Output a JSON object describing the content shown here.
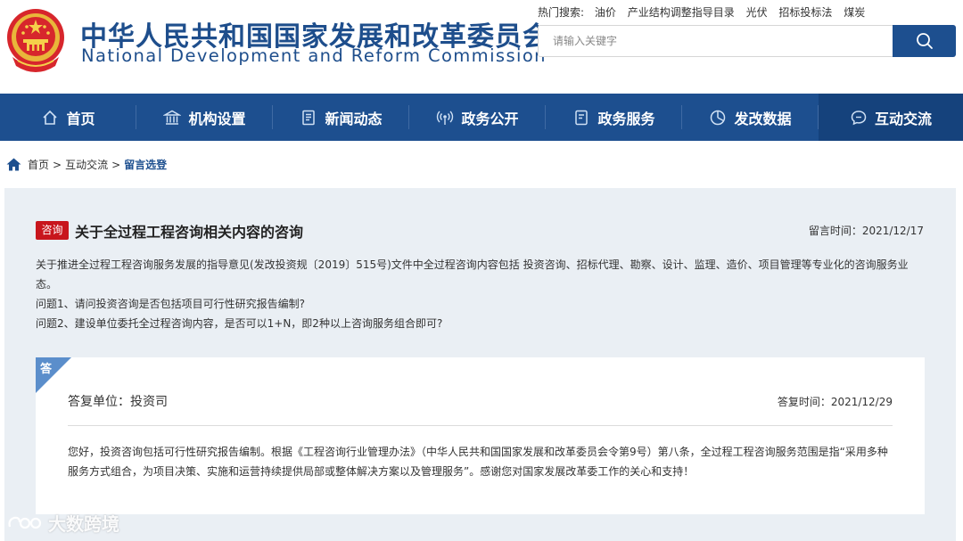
{
  "header": {
    "title_cn": "中华人民共和国国家发展和改革委员会",
    "title_en": "National Development and Reform Commission",
    "hot_label": "热门搜索:",
    "hot_items": [
      "油价",
      "产业结构调整指导目录",
      "光伏",
      "招标投标法",
      "煤炭"
    ],
    "search_placeholder": "请输入关键字"
  },
  "nav": {
    "items": [
      {
        "label": "首页",
        "icon": "home-icon"
      },
      {
        "label": "机构设置",
        "icon": "institution-icon"
      },
      {
        "label": "新闻动态",
        "icon": "news-icon"
      },
      {
        "label": "政务公开",
        "icon": "broadcast-icon"
      },
      {
        "label": "政务服务",
        "icon": "service-icon"
      },
      {
        "label": "发改数据",
        "icon": "pie-chart-icon"
      },
      {
        "label": "互动交流",
        "icon": "chat-icon"
      }
    ],
    "active_index": 6
  },
  "breadcrumb": {
    "items": [
      "首页",
      "互动交流"
    ],
    "current": "留言选登",
    "separator": ">"
  },
  "question": {
    "tag": "咨询",
    "title": "关于全过程工程咨询相关内容的咨询",
    "time": "留言时间：2021/12/17",
    "paragraphs": [
      "关于推进全过程工程咨询服务发展的指导意见(发改投资规〔2019〕515号)文件中全过程咨询内容包括 投资咨询、招标代理、勘察、设计、监理、造价、项目管理等专业化的咨询服务业态。",
      "问题1、请问投资咨询是否包括项目可行性研究报告编制?",
      "问题2、建设单位委托全过程咨询内容，是否可以1+N，即2种以上咨询服务组合即可?"
    ]
  },
  "answer": {
    "badge": "答",
    "unit": "答复单位：投资司",
    "time": "答复时间：2021/12/29",
    "body": "您好，投资咨询包括可行性研究报告编制。根据《工程咨询行业管理办法》（中华人民共和国国家发展和改革委员会令第9号）第八条，全过程工程咨询服务范围是指“采用多种服务方式组合，为项目决策、实施和运营持续提供局部或整体解决方案以及管理服务”。感谢您对国家发展改革委工作的关心和支持！"
  },
  "watermark": "大数跨境",
  "colors": {
    "brand": "#1d4f8f",
    "nav_active": "#15427c",
    "tag_red": "#c8161d",
    "panel_bg": "#eaeff4",
    "badge_blue": "#5b8ecb"
  }
}
